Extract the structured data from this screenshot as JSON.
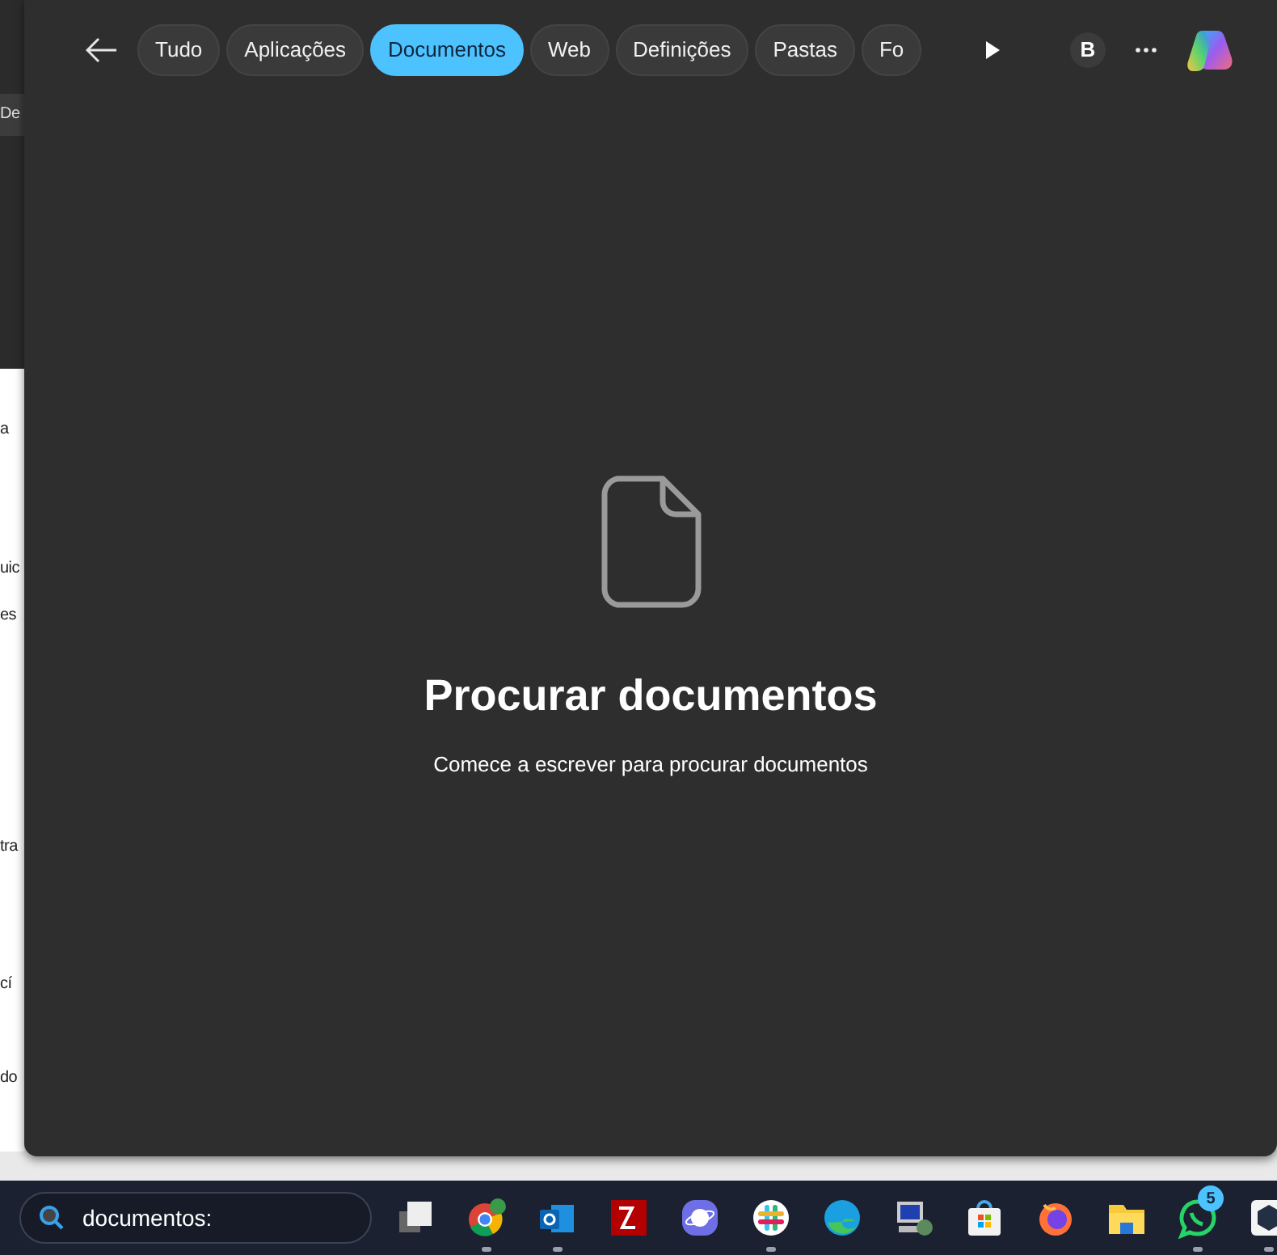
{
  "background_window": {
    "fragments": [
      "De",
      "a",
      "uic",
      "es",
      "tra",
      "cí",
      "do"
    ]
  },
  "search_panel": {
    "filters": [
      {
        "label": "Tudo",
        "selected": false
      },
      {
        "label": "Aplicações",
        "selected": false
      },
      {
        "label": "Documentos",
        "selected": true
      },
      {
        "label": "Web",
        "selected": false
      },
      {
        "label": "Definições",
        "selected": false
      },
      {
        "label": "Pastas",
        "selected": false
      },
      {
        "label": "Fo",
        "selected": false
      }
    ],
    "account_initial": "B",
    "empty_state": {
      "title": "Procurar documentos",
      "message": "Comece a escrever para procurar documentos"
    }
  },
  "taskbar": {
    "search": {
      "value": "documentos:"
    },
    "apps": [
      {
        "kind": "taskview",
        "running": false
      },
      {
        "kind": "chrome",
        "running": true
      },
      {
        "kind": "outlook",
        "running": true
      },
      {
        "kind": "filezilla",
        "running": false
      },
      {
        "kind": "browser",
        "running": false
      },
      {
        "kind": "slack",
        "running": true
      },
      {
        "kind": "edge",
        "running": false
      },
      {
        "kind": "remote",
        "running": false
      },
      {
        "kind": "store",
        "running": false
      },
      {
        "kind": "firefox",
        "running": false
      },
      {
        "kind": "folder",
        "running": false
      },
      {
        "kind": "whatsapp",
        "running": true,
        "badge": "5"
      },
      {
        "kind": "cube",
        "running": true
      }
    ]
  }
}
